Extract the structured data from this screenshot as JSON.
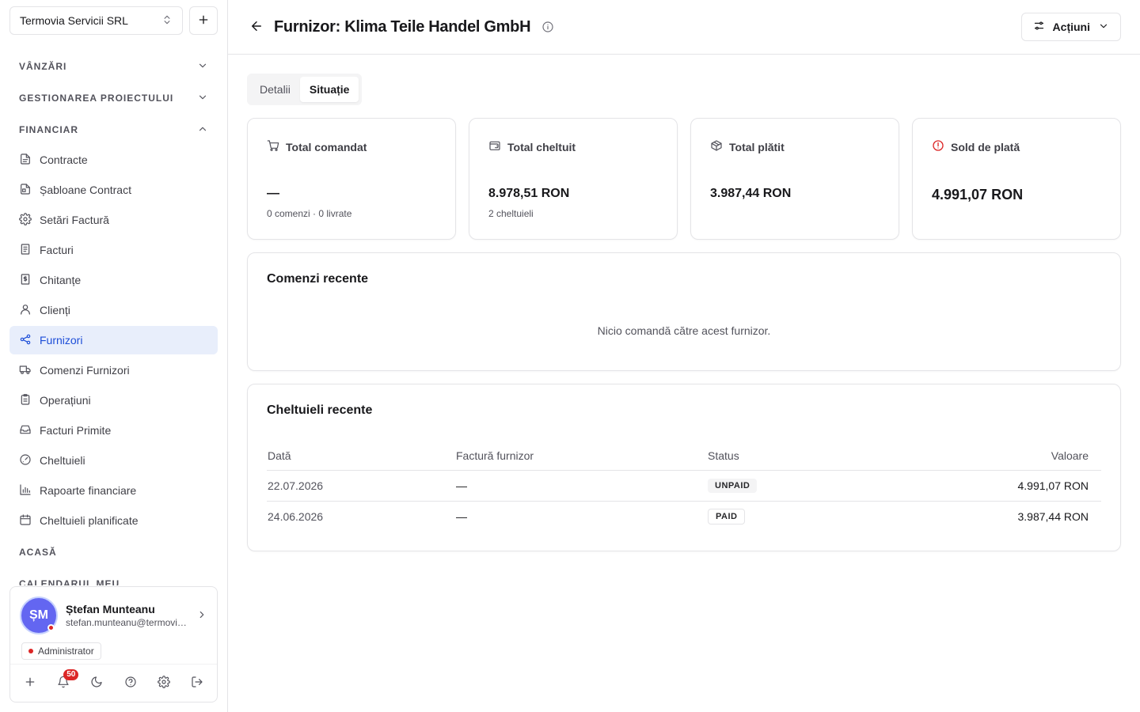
{
  "sidebar": {
    "org_name": "Termovia Servicii SRL",
    "sections": [
      {
        "label": "VÂNZĂRI",
        "expanded": false
      },
      {
        "label": "GESTIONAREA PROIECTULUI",
        "expanded": false
      },
      {
        "label": "FINANCIAR",
        "expanded": true
      }
    ],
    "items": [
      {
        "label": "Contracte",
        "icon": "file-text-icon"
      },
      {
        "label": "Șabloane Contract",
        "icon": "file-template-icon"
      },
      {
        "label": "Setări Factură",
        "icon": "gear-icon"
      },
      {
        "label": "Facturi",
        "icon": "invoice-icon"
      },
      {
        "label": "Chitanțe",
        "icon": "receipt-icon"
      },
      {
        "label": "Clienți",
        "icon": "user-icon"
      },
      {
        "label": "Furnizori",
        "icon": "supplier-icon",
        "active": true
      },
      {
        "label": "Comenzi Furnizori",
        "icon": "truck-icon"
      },
      {
        "label": "Operațiuni",
        "icon": "clipboard-icon"
      },
      {
        "label": "Facturi Primite",
        "icon": "inbox-icon"
      },
      {
        "label": "Cheltuieli",
        "icon": "gauge-icon"
      },
      {
        "label": "Rapoarte financiare",
        "icon": "bar-chart-icon"
      },
      {
        "label": "Cheltuieli planificate",
        "icon": "calendar-icon"
      }
    ],
    "section_acasa": "ACASĂ",
    "section_calendar": "CALENDARUL MEU",
    "user": {
      "initials": "ȘM",
      "name": "Ștefan Munteanu",
      "email": "stefan.munteanu@termovia.ro",
      "role": "Administrator",
      "notifications": "50"
    }
  },
  "header": {
    "title": "Furnizor: Klima Teile Handel GmbH",
    "actions_label": "Acțiuni"
  },
  "tabs": [
    {
      "label": "Detalii",
      "active": false
    },
    {
      "label": "Situație",
      "active": true
    }
  ],
  "stats": [
    {
      "label": "Total comandat",
      "value": "—",
      "sub": "0 comenzi · 0 livrate",
      "icon": "cart-icon"
    },
    {
      "label": "Total cheltuit",
      "value": "8.978,51 RON",
      "sub": "2 cheltuieli",
      "icon": "wallet-icon"
    },
    {
      "label": "Total plătit",
      "value": "3.987,44 RON",
      "sub": "",
      "icon": "package-icon"
    },
    {
      "label": "Sold de plată",
      "value": "4.991,07 RON",
      "sub": "",
      "icon": "alert-circle-icon",
      "accent": "#dc2626"
    }
  ],
  "orders": {
    "title": "Comenzi recente",
    "empty": "Nicio comandă către acest furnizor."
  },
  "expenses": {
    "title": "Cheltuieli recente",
    "columns": [
      "Dată",
      "Factură furnizor",
      "Status",
      "Valoare"
    ],
    "rows": [
      {
        "date": "22.07.2026",
        "invoice": "—",
        "status": "UNPAID",
        "value": "4.991,07 RON"
      },
      {
        "date": "24.06.2026",
        "invoice": "—",
        "status": "PAID",
        "value": "3.987,44 RON"
      }
    ]
  }
}
